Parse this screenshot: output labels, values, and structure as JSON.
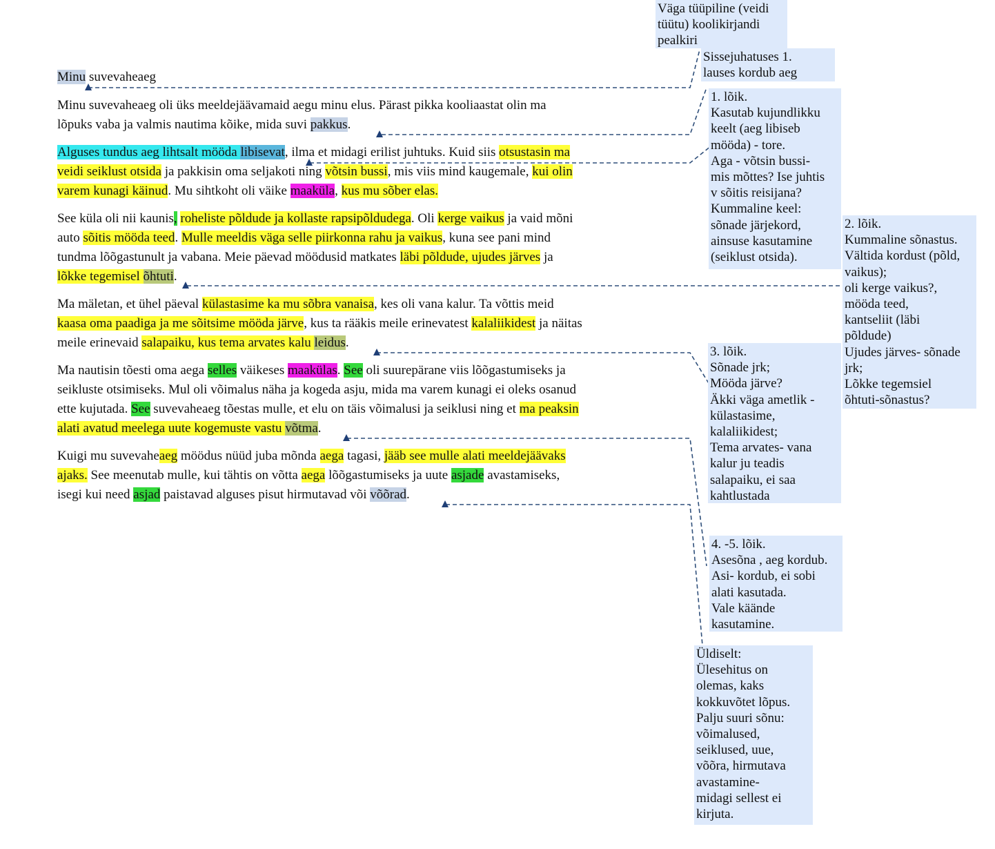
{
  "document": {
    "title_parts": [
      {
        "t": "Minu",
        "hl": "note"
      },
      {
        "t": " suvevaheaeg",
        "hl": ""
      }
    ],
    "lines": [
      [
        {
          "t": "Minu suvevaheaeg oli üks meeldejäävamaid aegu minu elus. Pärast pikka kooliaastat olin ma",
          "hl": ""
        }
      ],
      [
        {
          "t": "lõpuks vaba ja valmis nautima kõike, mida suvi ",
          "hl": ""
        },
        {
          "t": "pakkus",
          "hl": "note"
        },
        {
          "t": ".",
          "hl": ""
        }
      ],
      [
        {
          "t": "Alguses tundus aeg lihtsalt mööda ",
          "hl": "cyan"
        },
        {
          "t": "libisevat",
          "hl": "blue"
        },
        {
          "t": ", ilma et midagi erilist juhtuks. Kuid siis ",
          "hl": ""
        },
        {
          "t": "otsustasin ma",
          "hl": "yellow"
        }
      ],
      [
        {
          "t": "veidi seiklust otsida",
          "hl": "yellow"
        },
        {
          "t": " ja pakkisin oma seljakoti ning ",
          "hl": ""
        },
        {
          "t": "võtsin bussi",
          "hl": "yellow"
        },
        {
          "t": ", mis viis mind kaugemale, ",
          "hl": ""
        },
        {
          "t": "kui olin",
          "hl": "yellow"
        }
      ],
      [
        {
          "t": "varem kunagi käinud",
          "hl": "yellow"
        },
        {
          "t": ". Mu sihtkoht oli väike ",
          "hl": ""
        },
        {
          "t": "maaküla",
          "hl": "magenta"
        },
        {
          "t": ", ",
          "hl": ""
        },
        {
          "t": "kus mu sõber elas.",
          "hl": "yellow"
        }
      ],
      [
        {
          "t": "See küla oli nii kaunis",
          "hl": ""
        },
        {
          "t": ",",
          "hl": "green"
        },
        {
          "t": " ",
          "hl": ""
        },
        {
          "t": "roheliste põldude ja kollaste rapsipõldudega",
          "hl": "yellow"
        },
        {
          "t": ". Oli ",
          "hl": ""
        },
        {
          "t": "kerge vaikus",
          "hl": "yellow"
        },
        {
          "t": " ja vaid mõni",
          "hl": ""
        }
      ],
      [
        {
          "t": "auto ",
          "hl": ""
        },
        {
          "t": "sõitis mööda teed",
          "hl": "yellow"
        },
        {
          "t": ". ",
          "hl": ""
        },
        {
          "t": "Mulle meeldis väga selle piirkonna rahu ja vaikus",
          "hl": "yellow"
        },
        {
          "t": ", kuna see pani mind",
          "hl": ""
        }
      ],
      [
        {
          "t": "tundma lõõgastunult ja vabana. Meie päevad möödusid matkates ",
          "hl": ""
        },
        {
          "t": "läbi põldude, ujudes järves",
          "hl": "yellow"
        },
        {
          "t": " ja",
          "hl": ""
        }
      ],
      [
        {
          "t": "lõkke tegemisel ",
          "hl": "yellow"
        },
        {
          "t": "õhtuti",
          "hl": "olive"
        },
        {
          "t": ".",
          "hl": ""
        }
      ],
      [
        {
          "t": "Ma mäletan, et ühel päeval ",
          "hl": ""
        },
        {
          "t": "külastasime ka mu sõbra vanaisa",
          "hl": "yellow"
        },
        {
          "t": ", kes oli vana kalur. Ta võttis meid",
          "hl": ""
        }
      ],
      [
        {
          "t": "kaasa oma paadiga ja me sõitsime mööda järve",
          "hl": "yellow"
        },
        {
          "t": ", kus ta rääkis meile erinevatest ",
          "hl": ""
        },
        {
          "t": "kalaliikidest",
          "hl": "yellow"
        },
        {
          "t": " ja näitas",
          "hl": ""
        }
      ],
      [
        {
          "t": "meile erinevaid ",
          "hl": ""
        },
        {
          "t": "salapaiku, kus tema arvates kalu ",
          "hl": "yellow"
        },
        {
          "t": "leidus",
          "hl": "olive"
        },
        {
          "t": ".",
          "hl": ""
        }
      ],
      [
        {
          "t": "Ma nautisin tõesti oma aega ",
          "hl": ""
        },
        {
          "t": "selles",
          "hl": "green"
        },
        {
          "t": " väikeses ",
          "hl": ""
        },
        {
          "t": "maakülas",
          "hl": "magenta"
        },
        {
          "t": ". ",
          "hl": ""
        },
        {
          "t": "See",
          "hl": "green"
        },
        {
          "t": " oli suurepärane viis lõõgastumiseks ja",
          "hl": ""
        }
      ],
      [
        {
          "t": "seikluste otsimiseks. Mul oli võimalus näha ja kogeda asju, mida ma varem kunagi ei oleks osanud",
          "hl": ""
        }
      ],
      [
        {
          "t": "ette kujutada. ",
          "hl": ""
        },
        {
          "t": "See",
          "hl": "green"
        },
        {
          "t": " suvevaheaeg tõestas mulle, et elu on täis võimalusi ja seiklusi ning et ",
          "hl": ""
        },
        {
          "t": "ma peaksin",
          "hl": "yellow"
        }
      ],
      [
        {
          "t": "alati avatud meelega uute kogemuste vastu ",
          "hl": "yellow"
        },
        {
          "t": "võtma",
          "hl": "olive"
        },
        {
          "t": ".",
          "hl": ""
        }
      ],
      [
        {
          "t": "Kuigi mu suvevahe",
          "hl": ""
        },
        {
          "t": "aeg",
          "hl": "yellow"
        },
        {
          "t": " möödus nüüd juba mõnda ",
          "hl": ""
        },
        {
          "t": "aega",
          "hl": "yellow"
        },
        {
          "t": " tagasi, ",
          "hl": ""
        },
        {
          "t": "jääb see mulle alati meeldejäävaks",
          "hl": "yellow"
        }
      ],
      [
        {
          "t": "ajaks.",
          "hl": "yellow"
        },
        {
          "t": " See meenutab mulle, kui tähtis on võtta ",
          "hl": ""
        },
        {
          "t": "aega",
          "hl": "yellow"
        },
        {
          "t": " lõõgastumiseks ja uute ",
          "hl": ""
        },
        {
          "t": "asjade",
          "hl": "green"
        },
        {
          "t": " avastamiseks,",
          "hl": ""
        }
      ],
      [
        {
          "t": "isegi kui need ",
          "hl": ""
        },
        {
          "t": "asjad",
          "hl": "green"
        },
        {
          "t": " paistavad alguses pisut hirmutavad või ",
          "hl": ""
        },
        {
          "t": "võõrad",
          "hl": "note"
        },
        {
          "t": ".",
          "hl": ""
        }
      ]
    ]
  },
  "comments": [
    {
      "lines": [
        "Väga tüüpiline (veidi",
        "tüütu) koolikirjandi",
        "pealkiri"
      ]
    },
    {
      "lines": [
        "Sissejuhatuses 1.",
        "lauses kordub aeg"
      ]
    },
    {
      "lines": [
        "1. lõik.",
        "Kasutab kujundlikku",
        "keelt (aeg libiseb",
        "mööda) - tore.",
        "Aga - võtsin bussi-",
        "mis mõttes? Ise juhtis",
        "v sõitis reisijana?",
        "Kummaline keel:",
        "sõnade järjekord,",
        "ainsuse kasutamine",
        "(seiklust otsida)."
      ]
    },
    {
      "lines": [
        "2. lõik.",
        "Kummaline sõnastus.",
        "Vältida kordust (põld,",
        "vaikus);",
        "oli kerge vaikus?,",
        "mööda teed,",
        "kantseliit (läbi",
        "põldude)",
        "Ujudes järves- sõnade",
        "jrk;",
        "Lõkke tegemsiel",
        "õhtuti-sõnastus?"
      ]
    },
    {
      "lines": [
        "3. lõik.",
        "Sõnade jrk;",
        "Mööda järve?",
        "Äkki väga ametlik -",
        "külastasime,",
        "kalaliikidest;",
        "Tema arvates- vana",
        "kalur ju teadis",
        "salapaiku, ei saa",
        "kahtlustada"
      ]
    },
    {
      "lines": [
        "4. -5. lõik.",
        "Asesõna , aeg kordub.",
        "Asi- kordub, ei sobi",
        "alati kasutada.",
        "Vale käände",
        "kasutamine."
      ]
    },
    {
      "lines": [
        "Üldiselt:",
        "Ülesehitus on",
        "olemas, kaks",
        "kokkuvõtet lõpus.",
        "Palju suuri sõnu:",
        "võimalused,",
        "seiklused, uue,",
        "võõra, hirmutava",
        "avastamine-",
        "midagi sellest ei",
        "kirjuta."
      ]
    }
  ],
  "colors": {
    "highlight_yellow": "#ffff38",
    "highlight_cyan": "#35e8ee",
    "highlight_blue": "#5ab6dc",
    "highlight_magenta": "#f020e8",
    "highlight_green": "#34d93c",
    "highlight_olive": "#b9c97a",
    "comment_anchor": "#c6d3e6",
    "comment_bg": "#dde9fb",
    "connector": "#2f4f7a"
  }
}
